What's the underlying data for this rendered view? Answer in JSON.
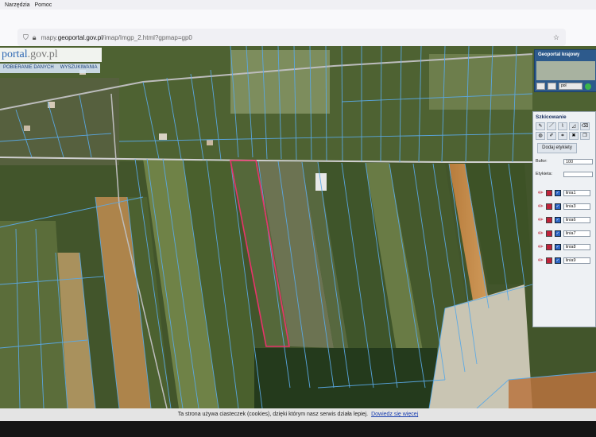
{
  "browser": {
    "menu": [
      "Narzędzia",
      "Pomoc"
    ],
    "url_prefix": "mapy.",
    "url_domain": "geoportal.gov.pl",
    "url_path": "/imap/Imgp_2.html?gpmap=gp0",
    "icons": [
      "shield-icon",
      "lock-icon",
      "star-icon"
    ]
  },
  "map": {
    "logo_main": "portal",
    "logo_tld": ".gov.pl",
    "nav": [
      "POBIERANIE DANYCH",
      "WYSZUKIWANIA"
    ],
    "colors": {
      "parcel_lines": "#5aa9e6",
      "selection": "#e8336a",
      "field_dark": "#3d5228",
      "field_light": "#8d9a6e",
      "field_orange": "#c88a46"
    }
  },
  "overview": {
    "title": "Geoportal krajowy",
    "lang": "pol"
  },
  "sketch": {
    "title": "Szkicowanie",
    "add_label_button": "Dodaj etykiety",
    "buffer_label": "Bufor:",
    "buffer_value": "100",
    "label_label": "Etykieta:",
    "label_value": "",
    "layers": [
      "linia1",
      "linia3",
      "linia6",
      "linia7",
      "linia8",
      "linia9"
    ]
  },
  "cookie": {
    "text": "Ta strona używa ciasteczek (cookies), dzięki którym nasz serwis działa lepiej.",
    "link": "Dowiedz się więcej"
  }
}
